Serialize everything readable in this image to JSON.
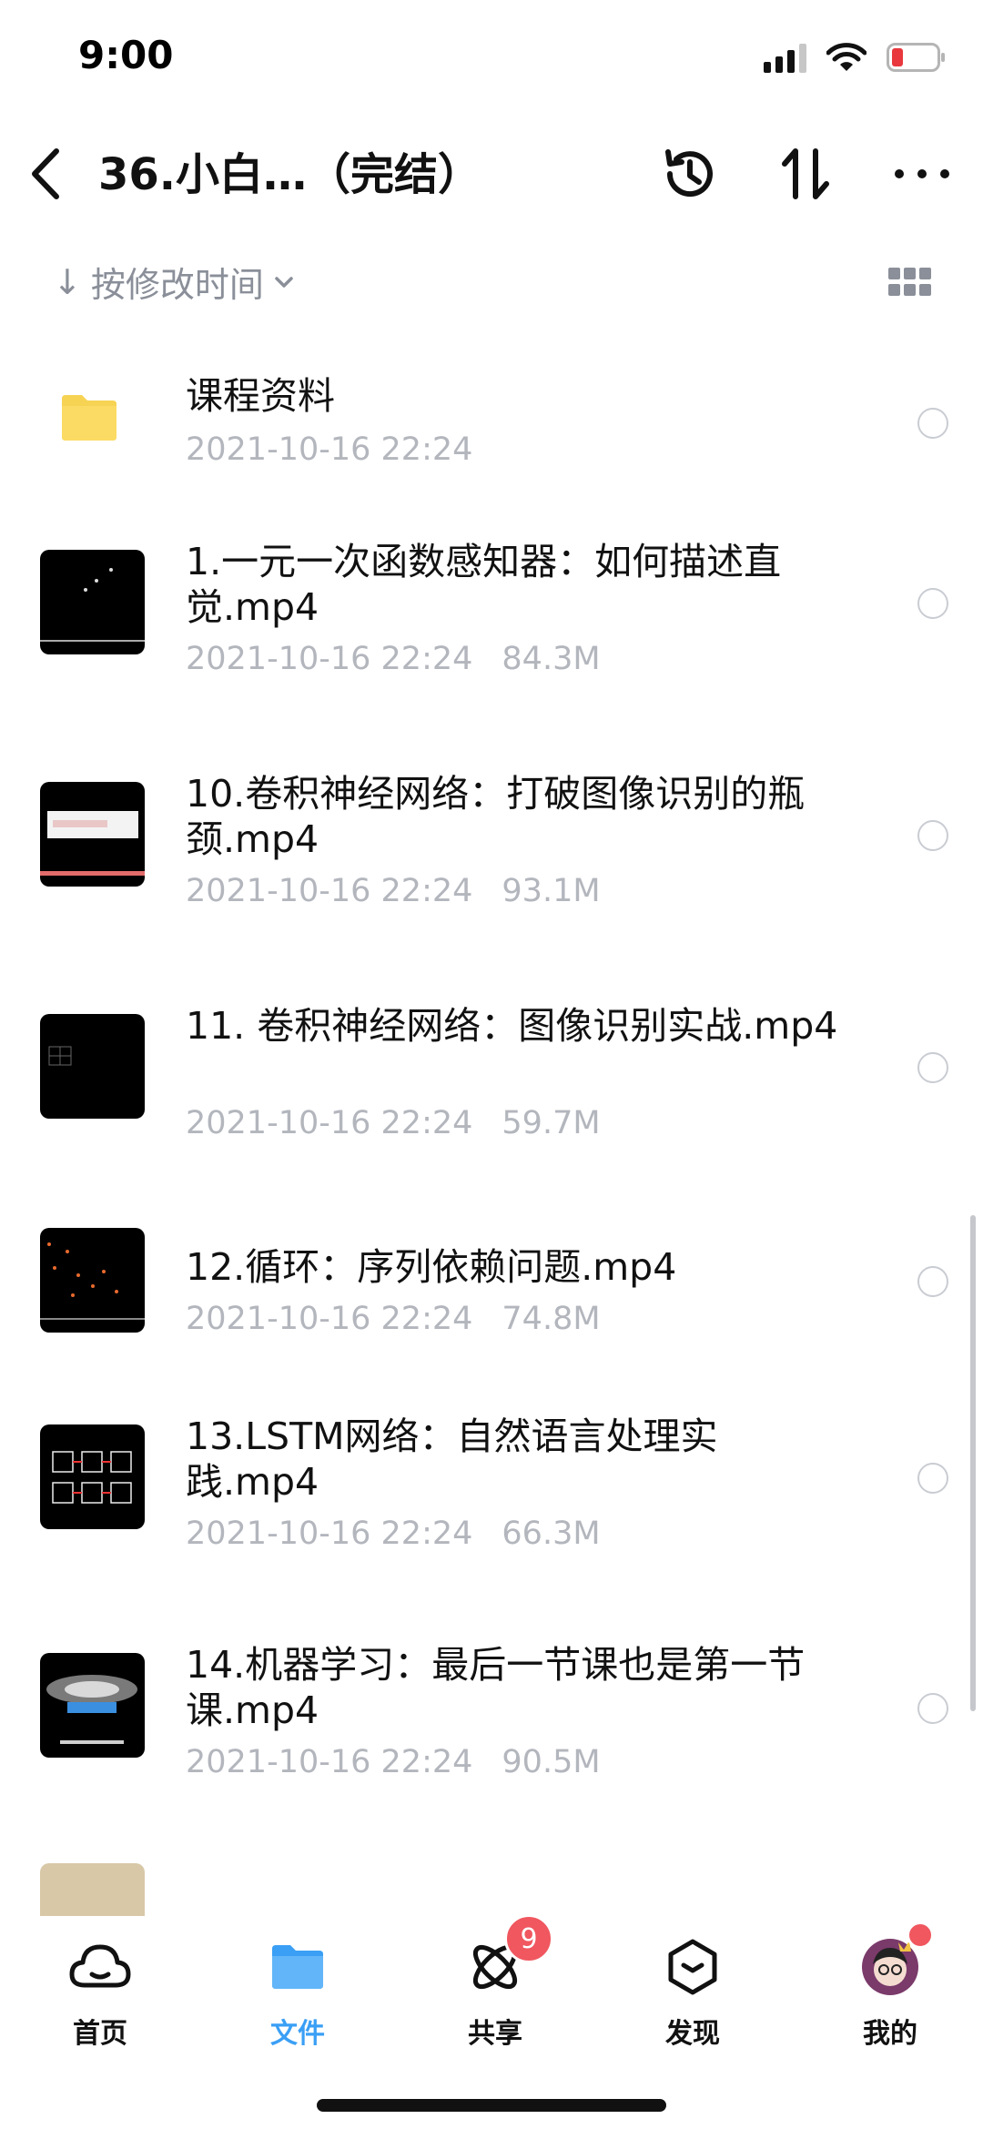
{
  "status_bar": {
    "time": "9:00"
  },
  "nav": {
    "title": "36.小白…（完结）"
  },
  "sort": {
    "label": "按修改时间",
    "arrow": "↓"
  },
  "files": [
    {
      "name": "课程资料",
      "date": "2021-10-16 22:24",
      "size": "",
      "type": "folder"
    },
    {
      "name": "1.一元一次函数感知器：如何描述直觉.mp4",
      "date": "2021-10-16 22:24",
      "size": "84.3M",
      "type": "video"
    },
    {
      "name": "10.卷积神经网络：打破图像识别的瓶颈.mp4",
      "date": "2021-10-16 22:24",
      "size": "93.1M",
      "type": "video"
    },
    {
      "name": "11. 卷积神经网络：图像识别实战.mp4",
      "date": "2021-10-16 22:24",
      "size": "59.7M",
      "type": "video"
    },
    {
      "name": "12.循环：序列依赖问题.mp4",
      "date": "2021-10-16 22:24",
      "size": "74.8M",
      "type": "video"
    },
    {
      "name": "13.LSTM网络：自然语言处理实践.mp4",
      "date": "2021-10-16 22:24",
      "size": "66.3M",
      "type": "video"
    },
    {
      "name": "14.机器学习：最后一节课也是第一节课.mp4",
      "date": "2021-10-16 22:24",
      "size": "90.5M",
      "type": "video"
    }
  ],
  "tabs": [
    {
      "label": "首页",
      "icon": "cloud-icon"
    },
    {
      "label": "文件",
      "icon": "folder-icon",
      "active": true
    },
    {
      "label": "共享",
      "icon": "atom-icon",
      "badge": "9"
    },
    {
      "label": "发现",
      "icon": "discover-icon"
    },
    {
      "label": "我的",
      "icon": "avatar"
    }
  ],
  "colors": {
    "accent": "#3a9ff5",
    "badge": "#f0575f",
    "folder": "#f7d354",
    "muted": "#b3b6bd"
  }
}
